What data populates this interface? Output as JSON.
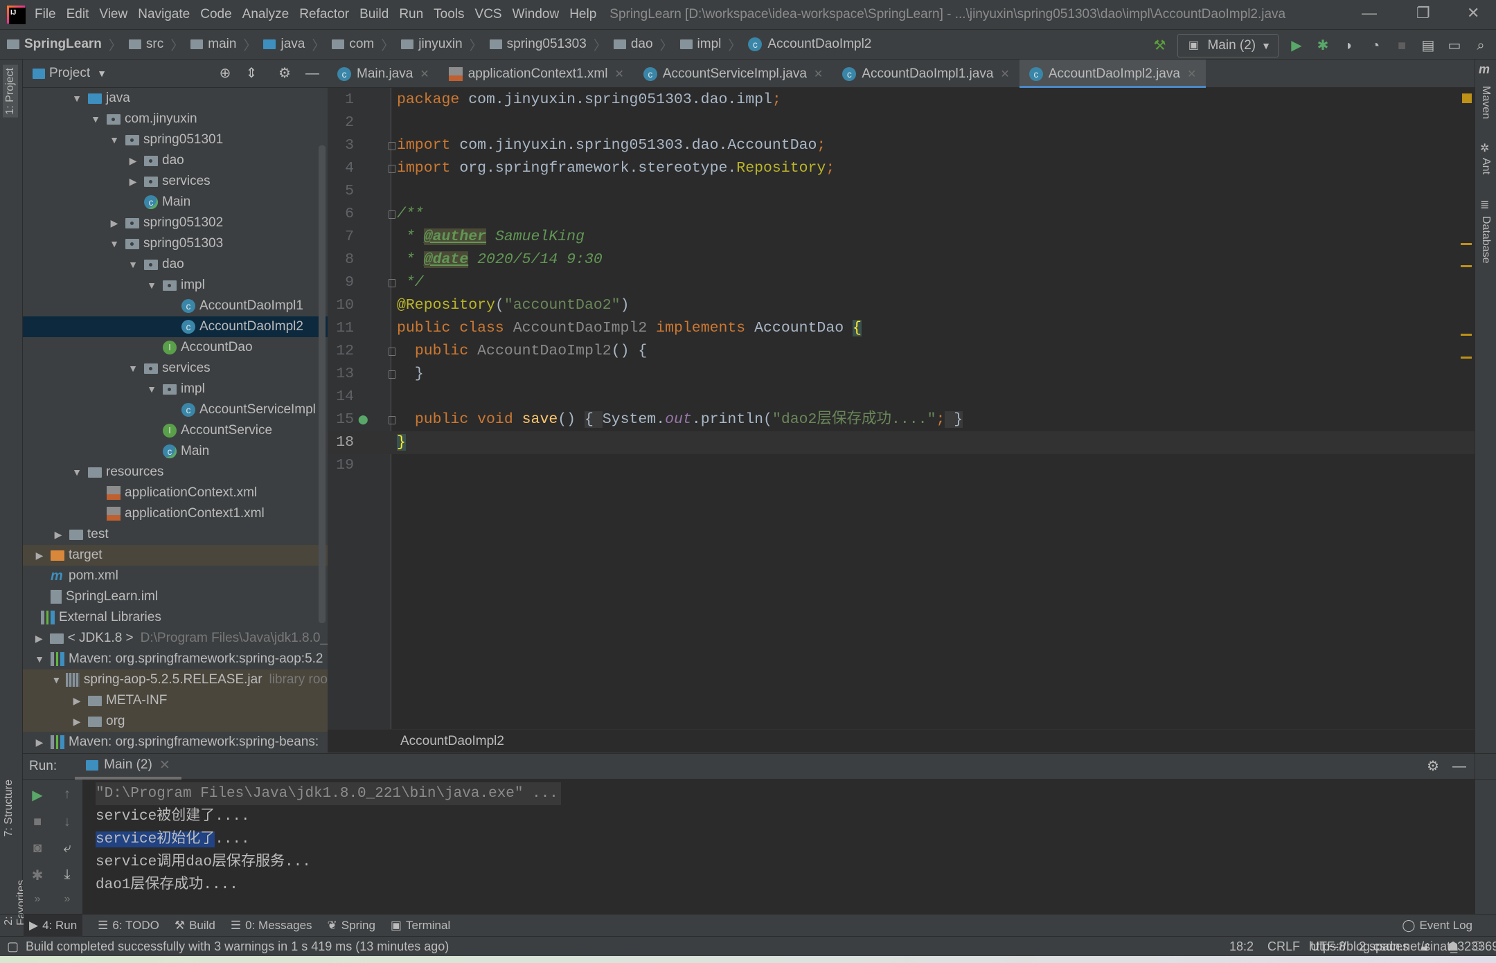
{
  "window": {
    "title": "SpringLearn [D:\\workspace\\idea-workspace\\SpringLearn] - ...\\jinyuxin\\spring051303\\dao\\impl\\AccountDaoImpl2.java",
    "menu": [
      "File",
      "Edit",
      "View",
      "Navigate",
      "Code",
      "Analyze",
      "Refactor",
      "Build",
      "Run",
      "Tools",
      "VCS",
      "Window",
      "Help"
    ]
  },
  "breadcrumb": [
    "SpringLearn",
    "src",
    "main",
    "java",
    "com",
    "jinyuxin",
    "spring051303",
    "dao",
    "impl",
    "AccountDaoImpl2"
  ],
  "run_config": "Main (2)",
  "left_strip": {
    "project": "1: Project",
    "structure": "7: Structure",
    "favorites": "2: Favorites"
  },
  "right_strip": {
    "maven": "Maven",
    "ant": "Ant",
    "database": "Database"
  },
  "project_panel": {
    "title": "Project",
    "tree": [
      {
        "label": "java",
        "level": 2,
        "state": "open",
        "icon": "folder-blue"
      },
      {
        "label": "com.jinyuxin",
        "level": 3,
        "state": "open",
        "icon": "package"
      },
      {
        "label": "spring051301",
        "level": 4,
        "state": "open",
        "icon": "package"
      },
      {
        "label": "dao",
        "level": 5,
        "state": "closed",
        "icon": "package"
      },
      {
        "label": "services",
        "level": 5,
        "state": "closed",
        "icon": "package"
      },
      {
        "label": "Main",
        "level": 5,
        "state": "leaf",
        "icon": "class"
      },
      {
        "label": "spring051302",
        "level": 4,
        "state": "closed",
        "icon": "package"
      },
      {
        "label": "spring051303",
        "level": 4,
        "state": "open",
        "icon": "package"
      },
      {
        "label": "dao",
        "level": 5,
        "state": "open",
        "icon": "package"
      },
      {
        "label": "impl",
        "level": 6,
        "state": "open",
        "icon": "package"
      },
      {
        "label": "AccountDaoImpl1",
        "level": 7,
        "state": "leaf",
        "icon": "class"
      },
      {
        "label": "AccountDaoImpl2",
        "level": 7,
        "state": "leaf",
        "icon": "class",
        "selected": true
      },
      {
        "label": "AccountDao",
        "level": 6,
        "state": "leaf",
        "icon": "interface"
      },
      {
        "label": "services",
        "level": 5,
        "state": "open",
        "icon": "package"
      },
      {
        "label": "impl",
        "level": 6,
        "state": "open",
        "icon": "package"
      },
      {
        "label": "AccountServiceImpl",
        "level": 7,
        "state": "leaf",
        "icon": "class"
      },
      {
        "label": "AccountService",
        "level": 6,
        "state": "leaf",
        "icon": "interface"
      },
      {
        "label": "Main",
        "level": 6,
        "state": "leaf",
        "icon": "class"
      },
      {
        "label": "resources",
        "level": 2,
        "state": "open",
        "icon": "folder"
      },
      {
        "label": "applicationContext.xml",
        "level": 3,
        "state": "leaf",
        "icon": "xml"
      },
      {
        "label": "applicationContext1.xml",
        "level": 3,
        "state": "leaf",
        "icon": "xml"
      },
      {
        "label": "test",
        "level": 1,
        "state": "closed",
        "icon": "folder"
      },
      {
        "label": "target",
        "level": 0,
        "state": "closed",
        "icon": "folder-orange",
        "excluded": true
      },
      {
        "label": "pom.xml",
        "level": 0,
        "state": "leaf",
        "icon": "maven"
      },
      {
        "label": "SpringLearn.iml",
        "level": 0,
        "state": "leaf",
        "icon": "iml"
      },
      {
        "label": "External Libraries",
        "level": -1,
        "state": "leaf",
        "icon": "library"
      },
      {
        "label": "< JDK1.8 >",
        "level": 0,
        "state": "closed",
        "icon": "jdk",
        "hint": "D:\\Program Files\\Java\\jdk1.8.0_"
      },
      {
        "label": "Maven: org.springframework:spring-aop:5.2",
        "level": 0,
        "state": "open",
        "icon": "library"
      },
      {
        "label": "spring-aop-5.2.5.RELEASE.jar",
        "level": 1,
        "state": "open",
        "icon": "jar",
        "hint": "library roo",
        "excluded": true
      },
      {
        "label": "META-INF",
        "level": 2,
        "state": "closed",
        "icon": "folder",
        "excluded": true
      },
      {
        "label": "org",
        "level": 2,
        "state": "closed",
        "icon": "folder",
        "excluded": true
      },
      {
        "label": "Maven: org.springframework:spring-beans:",
        "level": 0,
        "state": "closed",
        "icon": "library"
      }
    ]
  },
  "editor": {
    "tabs": [
      {
        "label": "Main.java",
        "icon": "class"
      },
      {
        "label": "applicationContext1.xml",
        "icon": "xml"
      },
      {
        "label": "AccountServiceImpl.java",
        "icon": "class"
      },
      {
        "label": "AccountDaoImpl1.java",
        "icon": "class"
      },
      {
        "label": "AccountDaoImpl2.java",
        "icon": "class",
        "active": true
      }
    ],
    "current_line": "18",
    "lines": [
      {
        "n": "1",
        "tokens": [
          [
            "kw",
            "package"
          ],
          [
            "pl",
            " com.jinyuxin.spring051303.dao.impl"
          ],
          [
            "kw",
            ";"
          ]
        ]
      },
      {
        "n": "2",
        "tokens": []
      },
      {
        "n": "3",
        "fold": true,
        "tokens": [
          [
            "kw",
            "import"
          ],
          [
            "pl",
            " com.jinyuxin.spring051303.dao.AccountDao"
          ],
          [
            "kw",
            ";"
          ]
        ]
      },
      {
        "n": "4",
        "fold": true,
        "tokens": [
          [
            "kw",
            "import"
          ],
          [
            "pl",
            " org.springframework.stereotype."
          ],
          [
            "ann",
            "Repository"
          ],
          [
            "kw",
            ";"
          ]
        ]
      },
      {
        "n": "5",
        "tokens": []
      },
      {
        "n": "6",
        "fold": true,
        "tokens": [
          [
            "doc",
            "/**"
          ]
        ]
      },
      {
        "n": "7",
        "tokens": [
          [
            "doc",
            " * "
          ],
          [
            "tag",
            "@auther"
          ],
          [
            "doc",
            " SamuelKing"
          ]
        ]
      },
      {
        "n": "8",
        "tokens": [
          [
            "doc",
            " * "
          ],
          [
            "tag",
            "@date"
          ],
          [
            "doc",
            " 2020/5/14 9:30"
          ]
        ]
      },
      {
        "n": "9",
        "fold": true,
        "tokens": [
          [
            "doc",
            " */"
          ]
        ]
      },
      {
        "n": "10",
        "tokens": [
          [
            "ann",
            "@Repository"
          ],
          [
            "pl",
            "("
          ],
          [
            "str",
            "\"accountDao2\""
          ],
          [
            "pl",
            ")"
          ]
        ]
      },
      {
        "n": "11",
        "tokens": [
          [
            "kw",
            "public class "
          ],
          [
            "gray",
            "AccountDaoImpl2"
          ],
          [
            "kw",
            " implements "
          ],
          [
            "pl",
            "AccountDao "
          ],
          [
            "brace",
            "{"
          ]
        ]
      },
      {
        "n": "12",
        "fold": true,
        "tokens": [
          [
            "pl",
            "  "
          ],
          [
            "kw",
            "public "
          ],
          [
            "gray",
            "AccountDaoImpl2"
          ],
          [
            "pl",
            "() {"
          ]
        ]
      },
      {
        "n": "13",
        "fold": true,
        "tokens": [
          [
            "pl",
            "  }"
          ]
        ]
      },
      {
        "n": "14",
        "tokens": []
      },
      {
        "n": "15",
        "fold": true,
        "tokens": [
          [
            "pl",
            "  "
          ],
          [
            "kw",
            "public void "
          ],
          [
            "meth",
            "save"
          ],
          [
            "pl",
            "() "
          ],
          [
            "fold",
            "{ "
          ],
          [
            "pl",
            "System."
          ],
          [
            "fld",
            "out"
          ],
          [
            "pl",
            ".println("
          ],
          [
            "str",
            "\"dao2层保存成功....\""
          ],
          [
            "kw",
            ";"
          ],
          [
            "fold",
            " }"
          ]
        ]
      },
      {
        "n": "18",
        "tokens": [
          [
            "brace",
            "}"
          ]
        ]
      },
      {
        "n": "19",
        "tokens": []
      }
    ],
    "breadcrumb": "AccountDaoImpl2"
  },
  "run_panel": {
    "label": "Run:",
    "tab": "Main (2)",
    "output": [
      {
        "text": "\"D:\\Program Files\\Java\\jdk1.8.0_221\\bin\\java.exe\" ...",
        "kind": "cmd"
      },
      {
        "text": "service被创建了...."
      },
      {
        "selected": "service初始化了",
        "text": "...."
      },
      {
        "text": "service调用dao层保存服务..."
      },
      {
        "text": "dao1层保存成功...."
      }
    ]
  },
  "tool_windows": [
    "4: Run",
    "6: TODO",
    "Build",
    "0: Messages",
    "Spring",
    "Terminal"
  ],
  "event_log": "Event Log",
  "status": {
    "message": "Build completed successfully with 3 warnings in 1 s 419 ms (13 minutes ago)",
    "position": "18:2",
    "line_sep": "CRLF",
    "encoding": "UTF-8",
    "indent": "2 spaces",
    "watermark": "https://blog.csdn.net/sinat_32336967"
  },
  "colors": {
    "accent": "#4a88c7",
    "selection": "#0d293e",
    "keyword": "#cc7832",
    "string": "#6a8759",
    "annotation": "#bbb529"
  }
}
